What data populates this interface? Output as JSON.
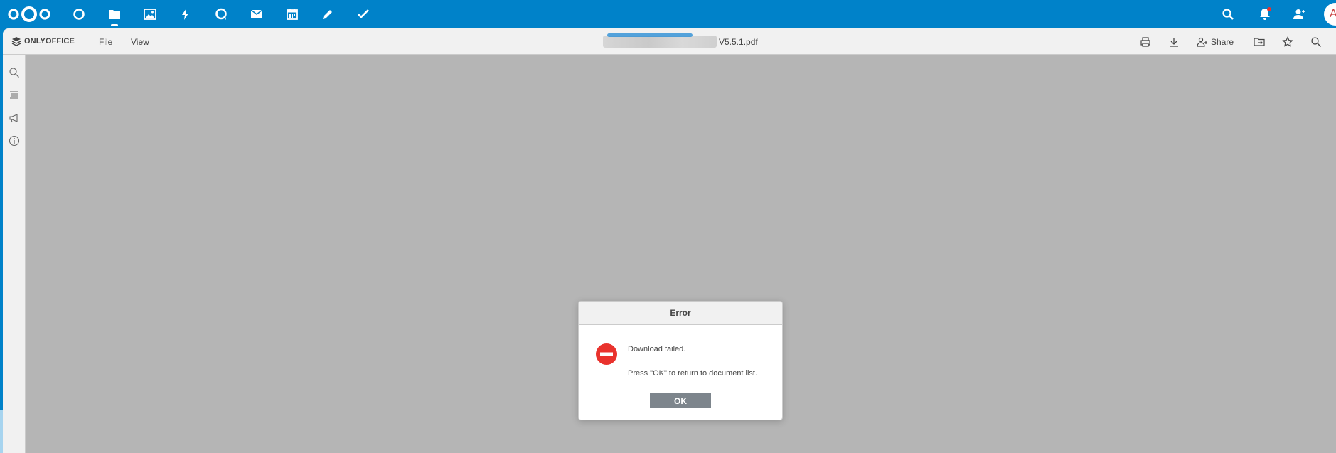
{
  "nc_header": {
    "apps": [
      {
        "name": "dashboard",
        "icon": "circle-icon"
      },
      {
        "name": "files",
        "icon": "folder-icon",
        "active": true
      },
      {
        "name": "photos",
        "icon": "image-icon"
      },
      {
        "name": "activity",
        "icon": "lightning-icon"
      },
      {
        "name": "talk",
        "icon": "chat-bubble-icon"
      },
      {
        "name": "mail",
        "icon": "mail-icon"
      },
      {
        "name": "calendar",
        "icon": "calendar-icon"
      },
      {
        "name": "notes",
        "icon": "pencil-icon"
      },
      {
        "name": "tasks",
        "icon": "check-icon"
      }
    ],
    "avatar_letter": "A"
  },
  "oo": {
    "brand": "ONLYOFFICE",
    "menu": {
      "file": "File",
      "view": "View"
    },
    "doc_title_suffix": "V5.5.1.pdf",
    "share_label": "Share"
  },
  "dialog": {
    "title": "Error",
    "message": "Download failed.",
    "instruction": "Press \"OK\" to return to document list.",
    "ok_label": "OK"
  },
  "colors": {
    "nc_blue": "#0082c9",
    "toolbar_bg": "#f1f1f1",
    "canvas_bg": "#b5b5b5",
    "error_red": "#e9322d",
    "ok_button": "#7d858c"
  }
}
